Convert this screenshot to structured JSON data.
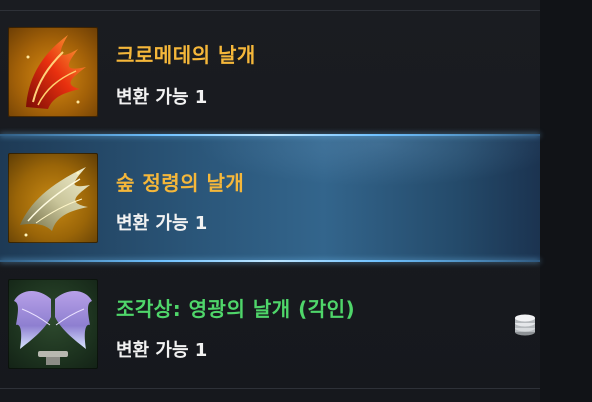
{
  "items": [
    {
      "name": "크로메데의 날개",
      "status": "변환 가능 1",
      "name_color": "#f5b73a",
      "selected": false,
      "thumb_icon": "fire-wing-icon"
    },
    {
      "name": "숲 정령의 날개",
      "status": "변환 가능 1",
      "name_color": "#f5b73a",
      "selected": true,
      "thumb_icon": "forest-spirit-wing-icon"
    },
    {
      "name": "조각상: 영광의 날개 (각인)",
      "status": "변환 가능 1",
      "name_color": "#4fd66a",
      "selected": false,
      "thumb_icon": "glory-wing-statue-icon",
      "badge_icon": "coin-stack-icon"
    }
  ]
}
